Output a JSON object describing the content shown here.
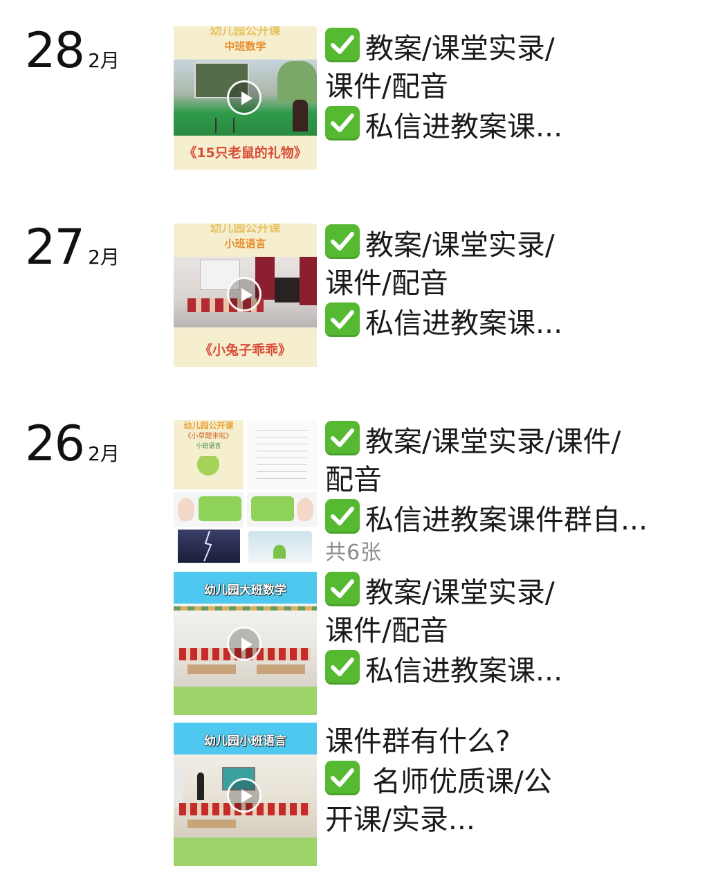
{
  "posts": [
    {
      "day": "28",
      "month": "2月",
      "thumb": {
        "header_top": "幼儿园公开课",
        "header_sub": "中班数学",
        "footer": "《15只老鼠的礼物》",
        "type": "video"
      },
      "lines": [
        "教案/课堂实录/",
        "课件/配音",
        "私信进教案课..."
      ]
    },
    {
      "day": "27",
      "month": "2月",
      "thumb": {
        "header_top": "幼儿园公开课",
        "header_sub": "小班语言",
        "footer": "《小兔子乖乖》",
        "type": "video"
      },
      "lines": [
        "教案/课堂实录/",
        "课件/配音",
        "私信进教案课..."
      ]
    },
    {
      "day": "26",
      "month": "2月",
      "thumb": {
        "header_top": "幼儿园公开课",
        "header_sub": "《小草醒来啦》",
        "header_sub2": "小班语言",
        "type": "images"
      },
      "lines": [
        "教案/课堂实录/课件/",
        "配音",
        "私信进教案课件群自..."
      ],
      "count": "共6张"
    },
    {
      "thumb": {
        "banner": "幼儿园大班数学",
        "type": "video"
      },
      "lines": [
        "教案/课堂实录/",
        "课件/配音",
        "私信进教案课..."
      ]
    },
    {
      "thumb": {
        "banner": "幼儿园小班语言",
        "type": "video"
      },
      "lines": [
        "课件群有什么?",
        "名师优质课/公",
        "开课/实录..."
      ]
    }
  ]
}
